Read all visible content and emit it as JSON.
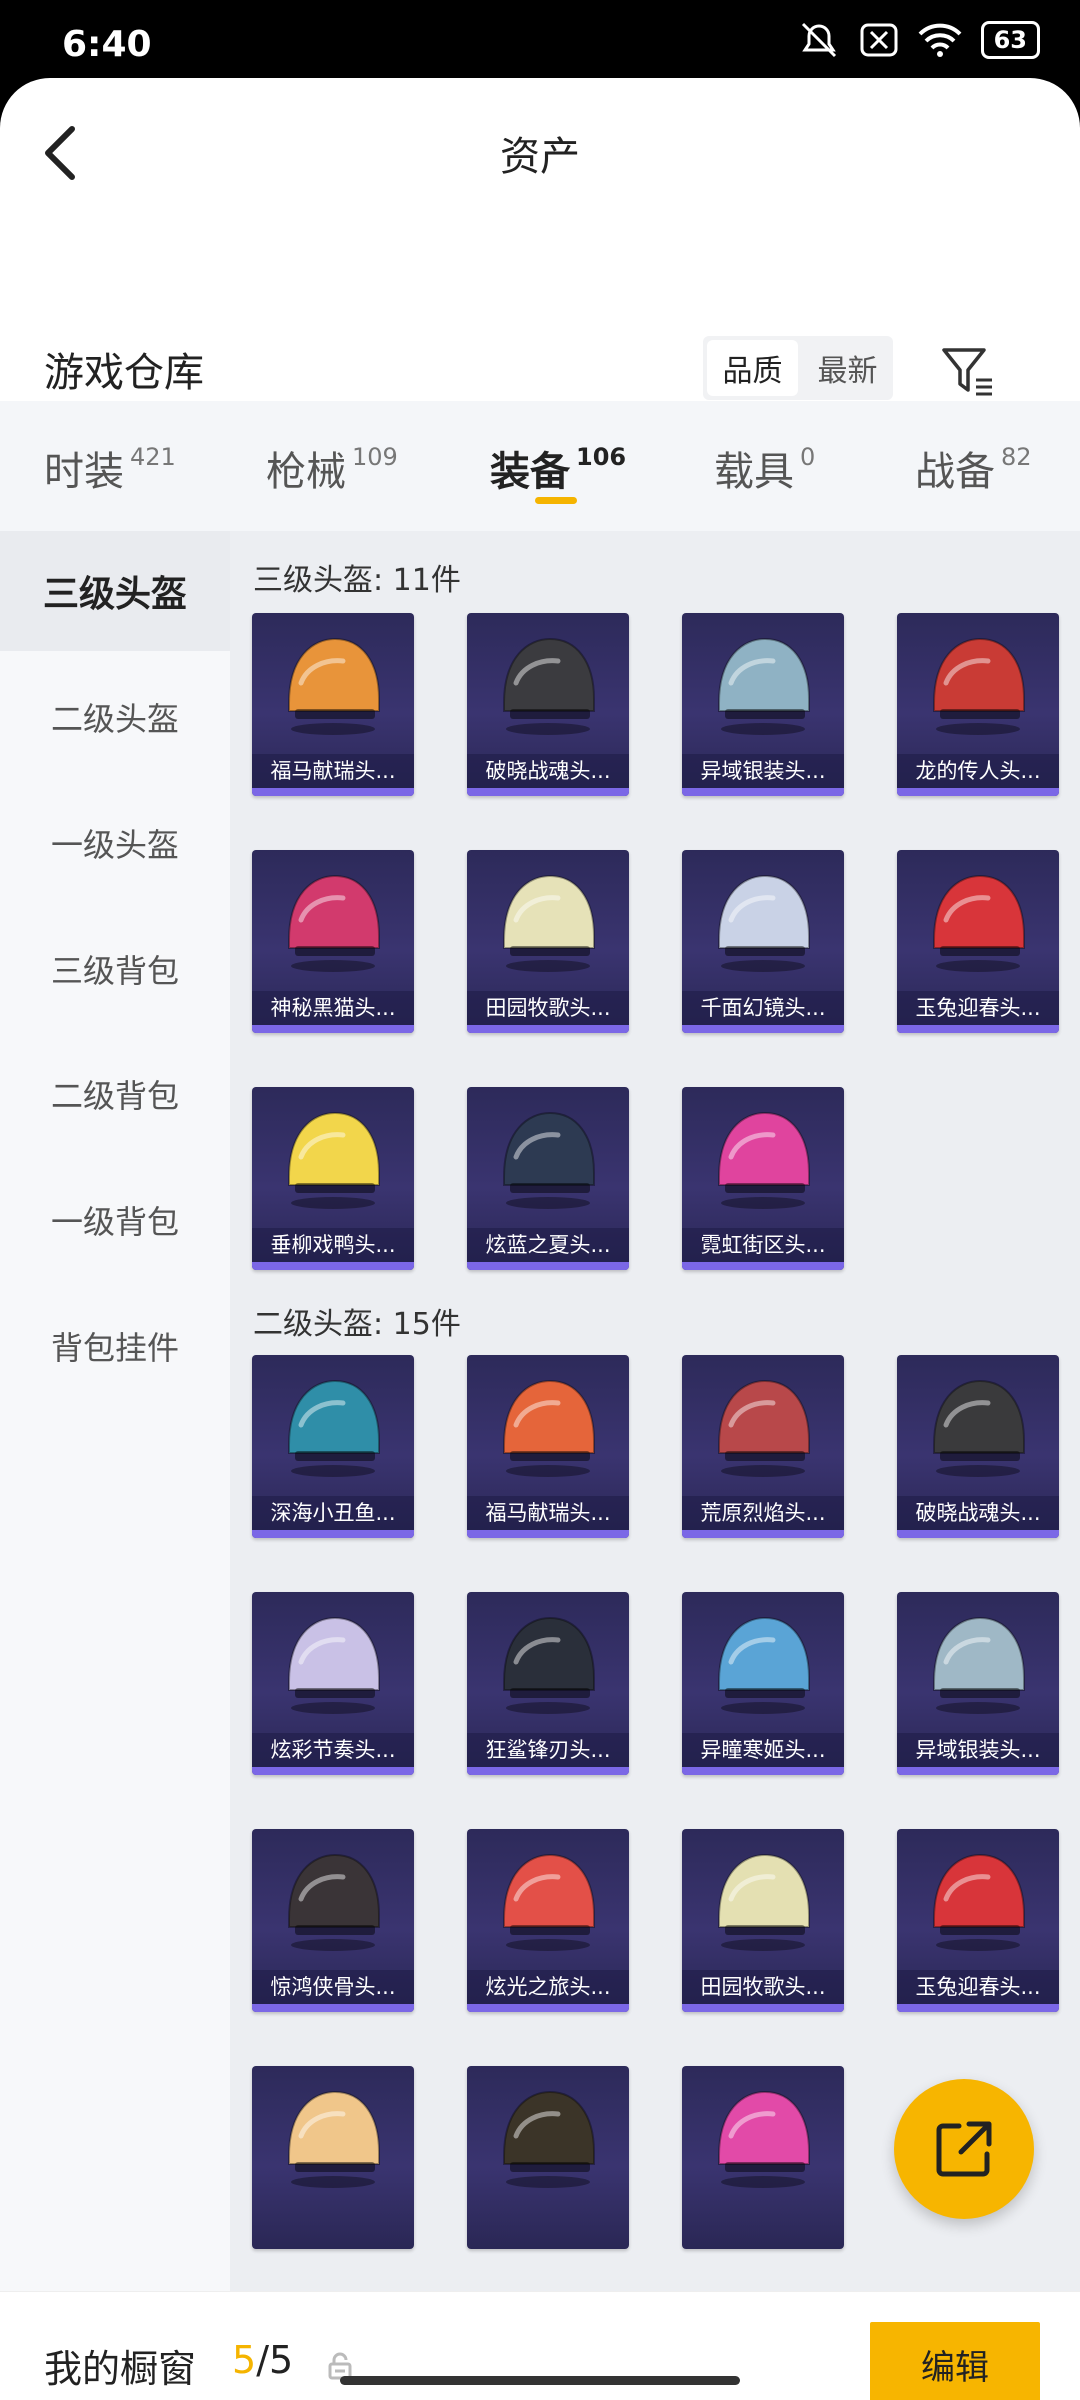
{
  "status": {
    "time": "6:40",
    "battery": "63"
  },
  "header": {
    "title": "资产"
  },
  "warehouse": {
    "title": "游戏仓库",
    "sort_quality": "品质",
    "sort_newest": "最新"
  },
  "tabs": [
    {
      "label": "时装",
      "count": "421"
    },
    {
      "label": "枪械",
      "count": "109"
    },
    {
      "label": "装备",
      "count": "106"
    },
    {
      "label": "载具",
      "count": "0"
    },
    {
      "label": "战备",
      "count": "82"
    }
  ],
  "sidebar": [
    {
      "label": "三级头盔"
    },
    {
      "label": "二级头盔"
    },
    {
      "label": "一级头盔"
    },
    {
      "label": "三级背包"
    },
    {
      "label": "二级背包"
    },
    {
      "label": "一级背包"
    },
    {
      "label": "背包挂件"
    }
  ],
  "sections": [
    {
      "title": "三级头盔: 11件",
      "items": [
        {
          "name": "福马献瑞头...",
          "color": "#e8943a"
        },
        {
          "name": "破晓战魂头...",
          "color": "#3b3b3f"
        },
        {
          "name": "异域银装头...",
          "color": "#8fb2c4"
        },
        {
          "name": "龙的传人头...",
          "color": "#c93b35"
        },
        {
          "name": "神秘黑猫头...",
          "color": "#d23a6d"
        },
        {
          "name": "田园牧歌头...",
          "color": "#e6e2b8"
        },
        {
          "name": "千面幻镜头...",
          "color": "#c9d2e6"
        },
        {
          "name": "玉兔迎春头...",
          "color": "#d8353a"
        },
        {
          "name": "垂柳戏鸭头...",
          "color": "#f2d64b"
        },
        {
          "name": "炫蓝之夏头...",
          "color": "#2d3a52"
        },
        {
          "name": "霓虹街区头...",
          "color": "#e0449e"
        }
      ]
    },
    {
      "title": "二级头盔: 15件",
      "items": [
        {
          "name": "深海小丑鱼...",
          "color": "#2f8ea8"
        },
        {
          "name": "福马献瑞头...",
          "color": "#e5653a"
        },
        {
          "name": "荒原烈焰头...",
          "color": "#b8484a"
        },
        {
          "name": "破晓战魂头...",
          "color": "#3a3a3c"
        },
        {
          "name": "炫彩节奏头...",
          "color": "#c9c1e6"
        },
        {
          "name": "狂鲨锋刃头...",
          "color": "#2a2f3a"
        },
        {
          "name": "异瞳寒姬头...",
          "color": "#5aa4d6"
        },
        {
          "name": "异域银装头...",
          "color": "#9fb8c6"
        },
        {
          "name": "惊鸿侠骨头...",
          "color": "#3a3437"
        },
        {
          "name": "炫光之旅头...",
          "color": "#e35048"
        },
        {
          "name": "田园牧歌头...",
          "color": "#e4e0b2"
        },
        {
          "name": "玉兔迎春头...",
          "color": "#d8353a"
        },
        {
          "name": "",
          "color": "#f0c68a"
        },
        {
          "name": "",
          "color": "#3b3428"
        },
        {
          "name": "",
          "color": "#e24aa8"
        }
      ]
    }
  ],
  "bottom": {
    "label": "我的橱窗",
    "current": "5",
    "total": "/5",
    "edit": "编辑"
  }
}
